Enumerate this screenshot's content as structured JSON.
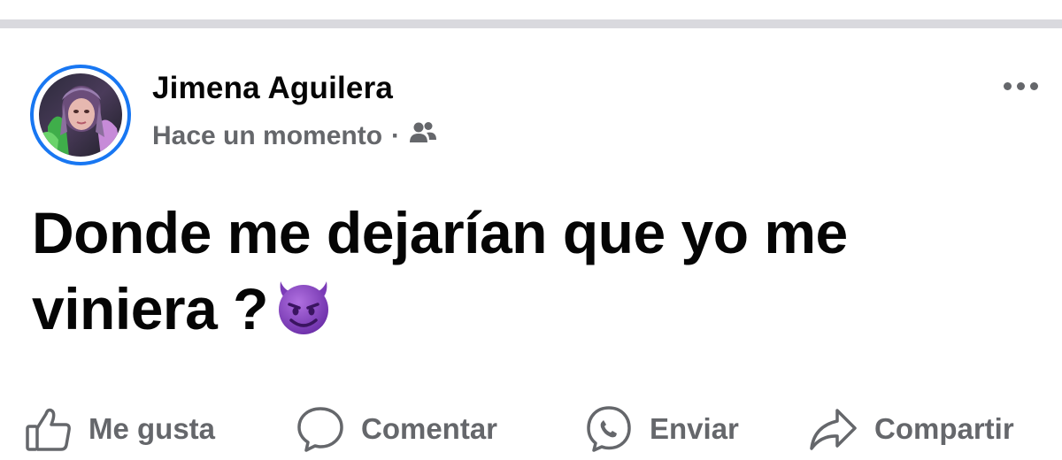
{
  "post": {
    "author_name": "Jimena Aguilera",
    "timestamp": "Hace un momento",
    "separator": "·",
    "audience_icon": "friends-icon",
    "more_icon": "more-options-icon",
    "text_line1": "Donde me dejarían que yo me",
    "text_line2": "viniera ?",
    "emoji": "smiling-face-with-horns",
    "avatar_ring_color": "#1877f2"
  },
  "actions": [
    {
      "label": "Me gusta",
      "icon": "like-icon"
    },
    {
      "label": "Comentar",
      "icon": "comment-icon"
    },
    {
      "label": "Enviar",
      "icon": "messenger-icon"
    },
    {
      "label": "Compartir",
      "icon": "share-icon"
    }
  ],
  "colors": {
    "primary_text": "#050505",
    "secondary_text": "#65676b",
    "divider": "#d9d9de",
    "accent": "#1877f2"
  }
}
